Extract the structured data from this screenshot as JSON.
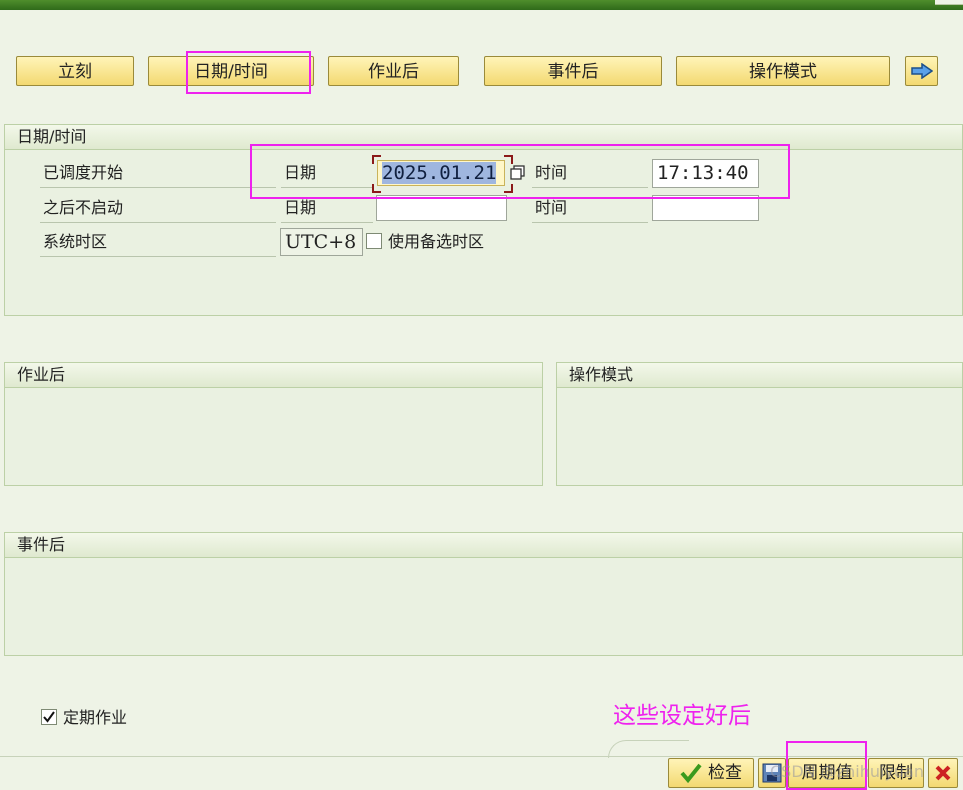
{
  "mode_buttons": {
    "immediate": "立刻",
    "date_time": "日期/时间",
    "after_job": "作业后",
    "after_event": "事件后",
    "operation_mode": "操作模式"
  },
  "date_time_group": {
    "title": "日期/时间",
    "scheduled_start_label": "已调度开始",
    "no_start_after_label": "之后不启动",
    "system_timezone_label": "系统时区",
    "date_label": "日期",
    "time_label": "时间",
    "start_date": "2025.01.21",
    "start_time": "17:13:40",
    "no_start_date": "",
    "no_start_time": "",
    "timezone_value": "UTC+8",
    "alt_timezone_label": "使用备选时区"
  },
  "after_job_group": {
    "title": "作业后"
  },
  "operation_mode_group": {
    "title": "操作模式"
  },
  "after_event_group": {
    "title": "事件后"
  },
  "periodic_job_label": "定期作业",
  "annotation_text": "这些设定好后",
  "footer": {
    "check_label": "检查",
    "period_values_label": "周期值",
    "restrictions_label": "限制"
  },
  "watermark": "CSDN @zhihuiyuan",
  "colors": {
    "highlight": "#ee22ee",
    "header_green": "#3f7c22",
    "button_yellow": "#f3d971"
  }
}
